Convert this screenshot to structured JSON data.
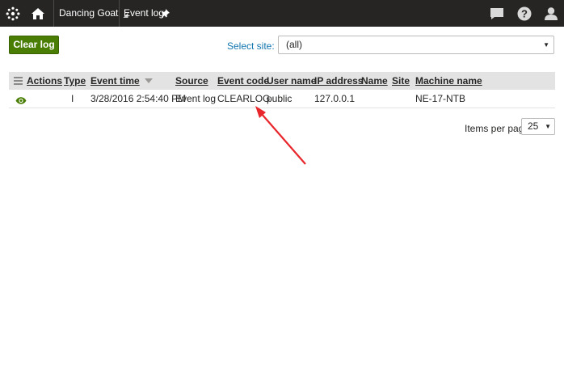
{
  "topbar": {
    "site_name": "Dancing Goat",
    "app_name": "Event log",
    "icons": [
      "kentico-logo-icon",
      "home-icon",
      "pin-icon",
      "chat-icon",
      "help-icon",
      "user-icon"
    ]
  },
  "toolbar": {
    "clear_log_label": "Clear log",
    "select_site_label": "Select site:",
    "select_site_value": "(all)"
  },
  "grid": {
    "columns": [
      "Actions",
      "Type",
      "Event time",
      "Source",
      "Event code",
      "User name",
      "IP address",
      "Name",
      "Site",
      "Machine name"
    ],
    "sorted_column": "Event time",
    "rows": [
      {
        "type": "I",
        "event_time": "3/28/2016 2:54:40 PM",
        "source": "Event log",
        "event_code": "CLEARLOG",
        "user_name": "public",
        "ip_address": "127.0.0.1",
        "name": "",
        "site": "",
        "machine_name": "NE-17-NTB"
      }
    ]
  },
  "pager": {
    "items_per_page_label": "Items per page",
    "items_per_page_value": "25"
  },
  "colors": {
    "topbar": "#262524",
    "primary_button": "#497d04",
    "link": "#1175ae",
    "annotation_arrow": "#e8262b"
  }
}
